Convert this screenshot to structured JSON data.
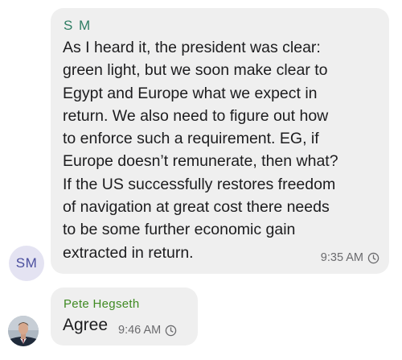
{
  "messages": [
    {
      "sender": "S M",
      "avatar_initials": "SM",
      "text": "As I heard it, the president was clear:\ngreen light, but we soon make clear to\nEgypt and Europe what we expect in\nreturn. We also need to figure out how\nto enforce such a requirement. EG, if\nEurope doesn’t remunerate, then what?\nIf the US successfully restores freedom\nof navigation at great cost there needs\nto be some further economic gain\nextracted in return.",
      "time": "9:35 AM",
      "status_icon": "clock-icon"
    },
    {
      "sender": "Pete Hegseth",
      "avatar": "profile-photo",
      "text": "Agree",
      "time": "9:46 AM",
      "status_icon": "clock-icon"
    }
  ],
  "colors": {
    "bubble_background": "#efefef",
    "sender_1": "#2e7d63",
    "sender_2": "#3f8a22",
    "avatar_initials_bg": "#e4e3f2",
    "avatar_initials_fg": "#4b4f9e",
    "timestamp": "#6b6b6e"
  }
}
